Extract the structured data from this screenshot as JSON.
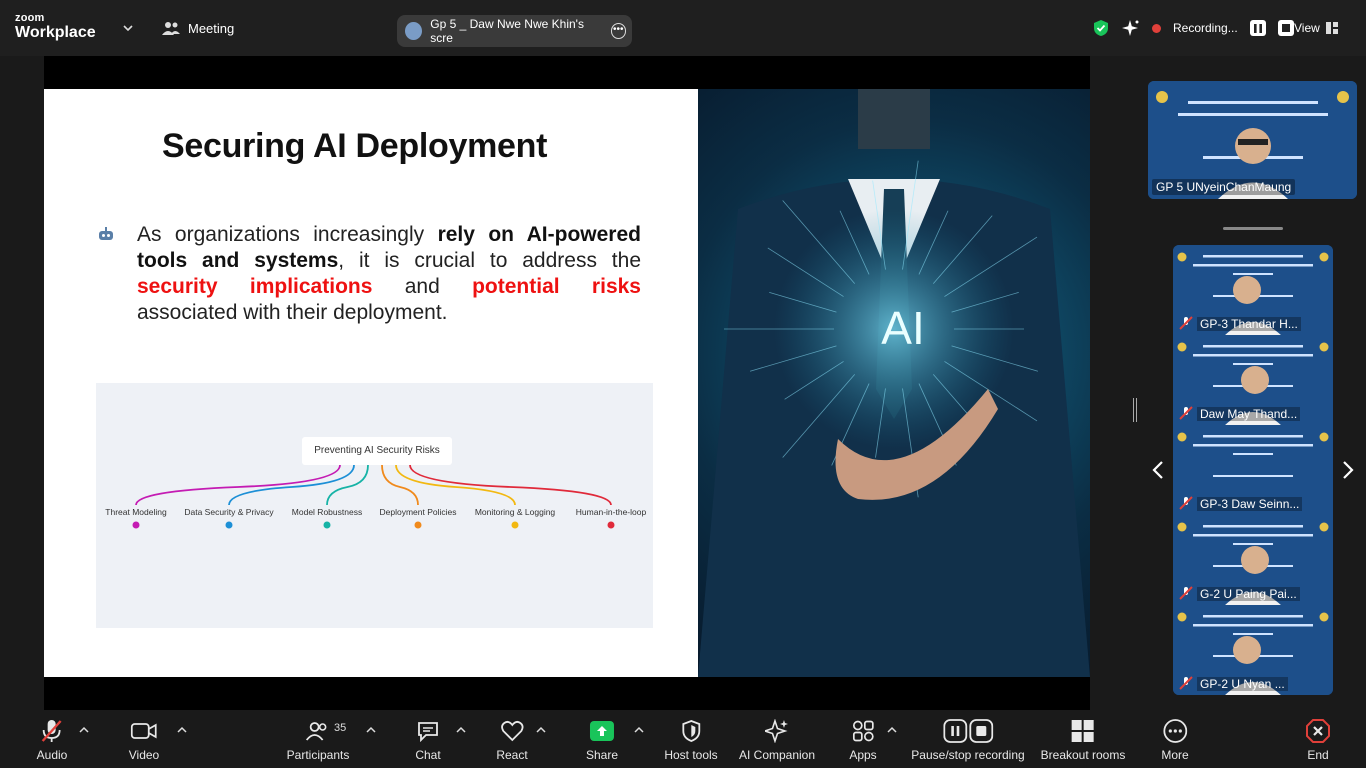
{
  "topbar": {
    "logo_small": "zoom",
    "logo_big": "Workplace",
    "meeting_label": "Meeting",
    "share_label": "Gp 5 _ Daw Nwe Nwe Khin's scre",
    "recording_label": "Recording...",
    "view_label": "View"
  },
  "slide": {
    "title": "Securing AI Deployment",
    "bullet_part1": "As organizations increasingly ",
    "bullet_bold": "rely on AI-powered tools and systems",
    "bullet_part2": ", it is crucial to address the ",
    "bullet_red1": "security implications",
    "bullet_part3": " and ",
    "bullet_red2": "potential risks",
    "bullet_part4": " associated with their deployment.",
    "diagram_center": "Preventing AI Security Risks",
    "diagram_items": [
      {
        "label": "Threat Modeling",
        "color": "#c41bb3",
        "num": "1"
      },
      {
        "label": "Data Security & Privacy",
        "color": "#1c8fd6",
        "num": "2"
      },
      {
        "label": "Model Robustness",
        "color": "#16b3a6",
        "num": "3"
      },
      {
        "label": "Deployment Policies",
        "color": "#f08a1c",
        "num": "4"
      },
      {
        "label": "Monitoring & Logging",
        "color": "#f2b811",
        "num": "5"
      },
      {
        "label": "Human-in-the-loop",
        "color": "#e02a3a",
        "num": "6"
      }
    ],
    "ai_text": "AI"
  },
  "participants_panel": {
    "top_name": "GP 5 UNyeinChanMaung",
    "tiles": [
      {
        "name": "GP-3 Thandar H..."
      },
      {
        "name": "Daw May Thand..."
      },
      {
        "name": "GP-3 Daw Seinn..."
      },
      {
        "name": "G-2 U Paing Pai..."
      },
      {
        "name": "GP-2  U Nyan ..."
      }
    ]
  },
  "toolbar": {
    "audio": "Audio",
    "video": "Video",
    "participants": "Participants",
    "participants_count": "35",
    "chat": "Chat",
    "react": "React",
    "share": "Share",
    "host_tools": "Host tools",
    "ai_companion": "AI Companion",
    "apps": "Apps",
    "pause_recording": "Pause/stop recording",
    "breakout_rooms": "Breakout rooms",
    "more": "More",
    "end": "End"
  },
  "colors": {
    "share_green": "#19c45a",
    "end_red": "#e0403a",
    "tile_blue": "#1d4f8a",
    "shield_green": "#19c45a"
  }
}
